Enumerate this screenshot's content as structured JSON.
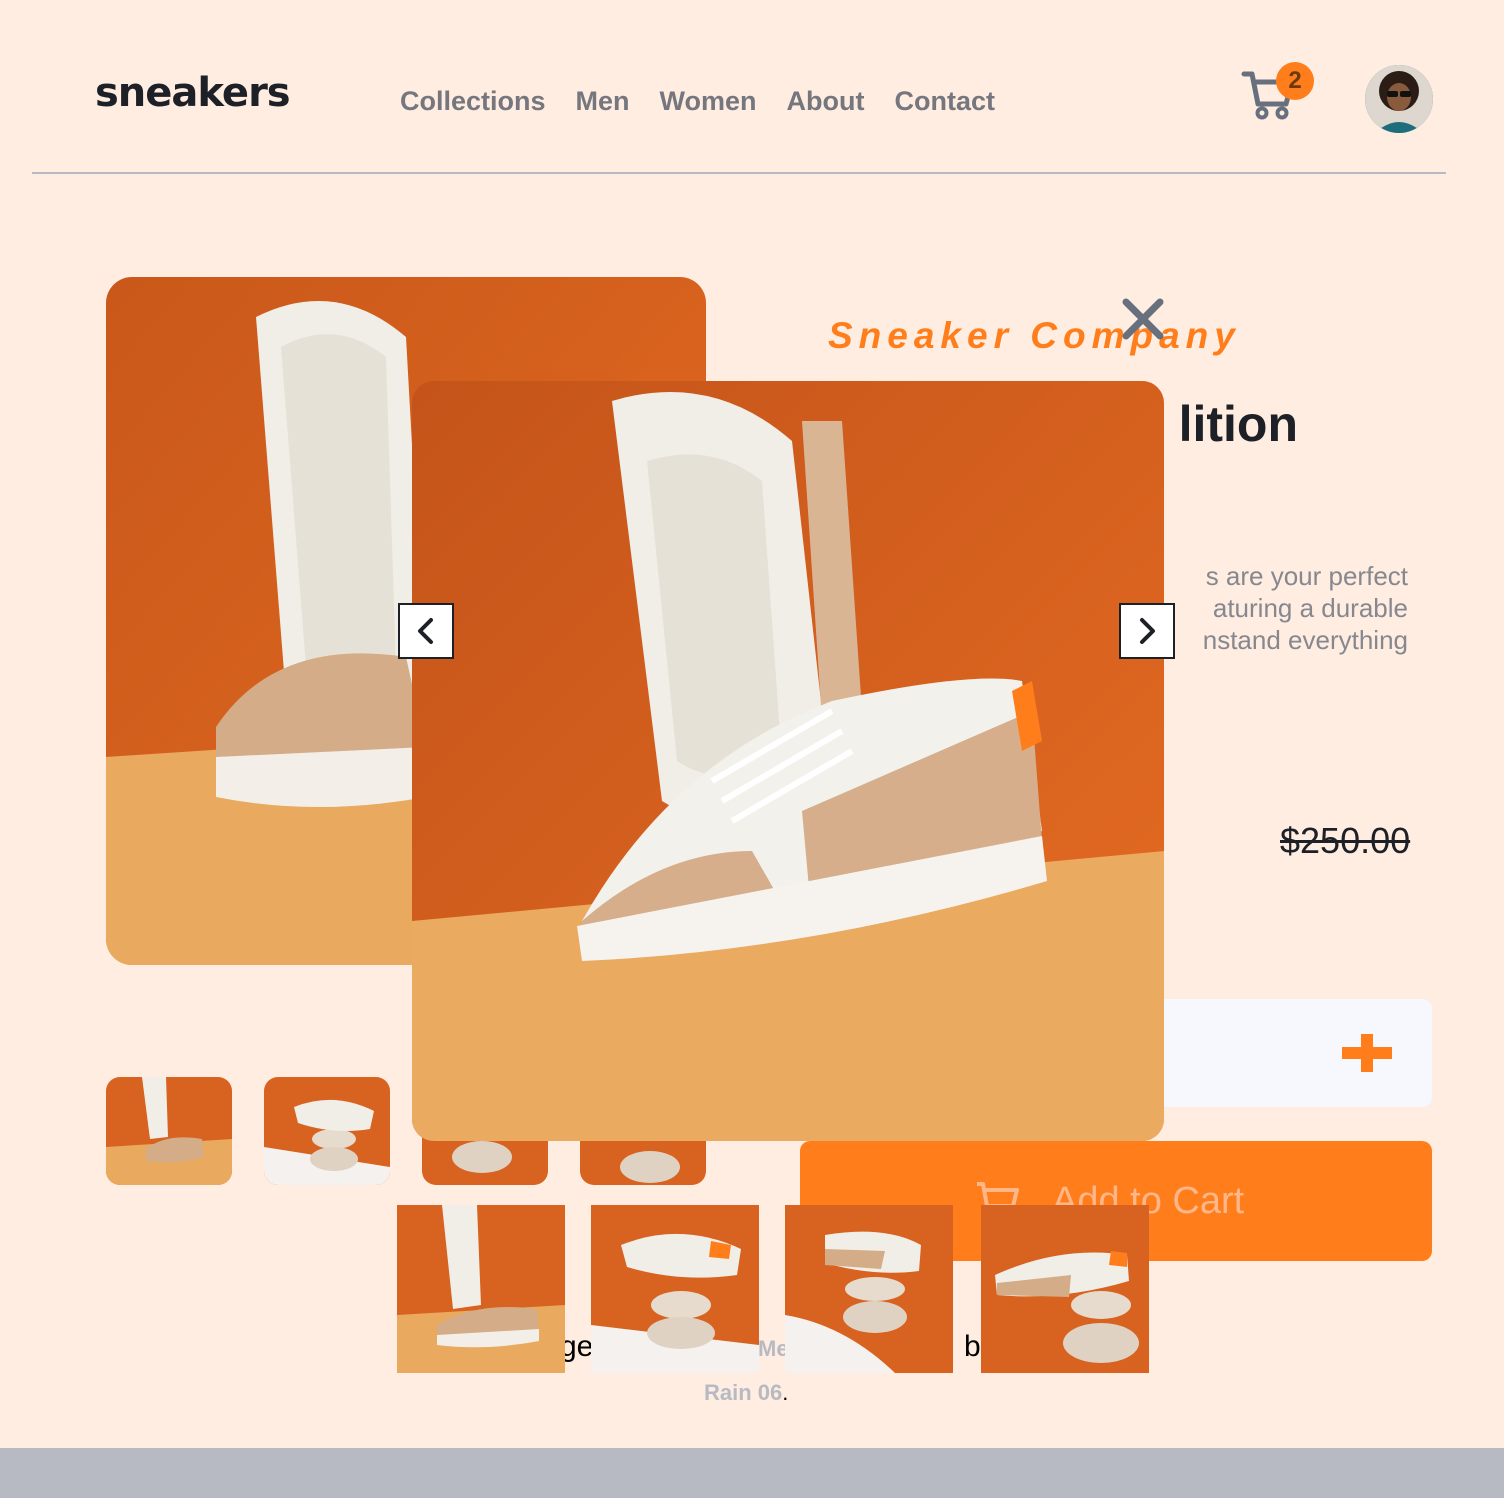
{
  "header": {
    "logo": "sneakers",
    "nav": [
      "Collections",
      "Men",
      "Women",
      "About",
      "Contact"
    ],
    "cart_count": "2"
  },
  "product": {
    "company": "Sneaker Company",
    "title_fragment": "lition",
    "description_lines": [
      "s are your perfect",
      "aturing a durable",
      "nstand everything"
    ],
    "old_price": "$250.00",
    "add_to_cart": "Add to Cart"
  },
  "attribution": {
    "frag_a": "ge",
    "frag_me": "Me",
    "frag_b": "b",
    "line2": "Rain 06",
    "line2_end": "."
  },
  "colors": {
    "accent": "#ff7e1b",
    "background": "#feede0",
    "text_dark": "#1d2026",
    "text_muted": "#75767e",
    "footer": "#b8bac3"
  },
  "icons": {
    "cart": "cart-icon",
    "close": "close-icon",
    "prev": "chevron-left-icon",
    "next": "chevron-right-icon",
    "plus": "plus-icon"
  }
}
